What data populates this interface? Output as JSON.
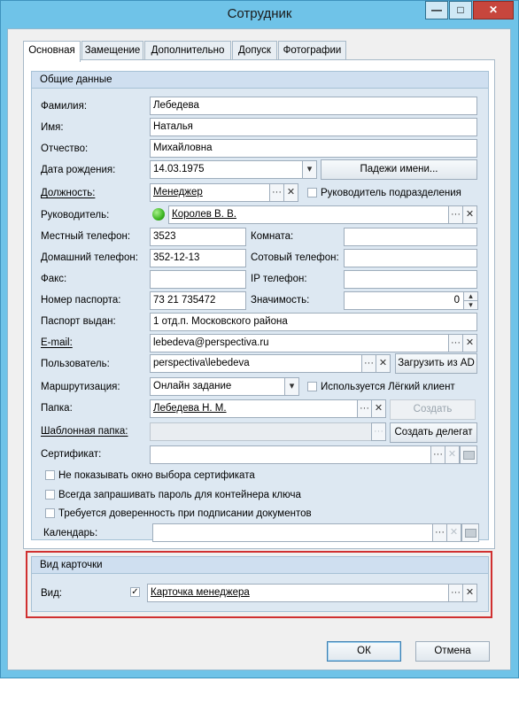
{
  "window": {
    "title": "Сотрудник",
    "minimize": "—",
    "maximize": "□",
    "close": "✕"
  },
  "tabs": [
    "Основная",
    "Замещение",
    "Дополнительно",
    "Допуск",
    "Фотографии"
  ],
  "general": {
    "header": "Общие данные",
    "last_name_label": "Фамилия:",
    "last_name": "Лебедева",
    "first_name_label": "Имя:",
    "first_name": "Наталья",
    "patronymic_label": "Отчество:",
    "patronymic": "Михайловна",
    "birth_date_label": "Дата рождения:",
    "birth_date": "14.03.1975",
    "name_cases_button": "Падежи имени...",
    "position_label": "Должность:",
    "position": "Менеджер",
    "department_head_label": "Руководитель подразделения",
    "manager_label": "Руководитель:",
    "manager": "Королев В. В.",
    "local_phone_label": "Местный телефон:",
    "local_phone": "3523",
    "room_label": "Комната:",
    "room": "",
    "home_phone_label": "Домашний телефон:",
    "home_phone": "352-12-13",
    "mobile_phone_label": "Сотовый телефон:",
    "mobile_phone": "",
    "fax_label": "Факс:",
    "fax": "",
    "ip_phone_label": "IP телефон:",
    "ip_phone": "",
    "passport_label": "Номер паспорта:",
    "passport": "73 21 735472",
    "importance_label": "Значимость:",
    "importance": "0",
    "passport_issued_label": "Паспорт выдан:",
    "passport_issued": "1 отд.п. Московского района",
    "email_label": "E-mail:",
    "email": "lebedeva@perspectiva.ru",
    "user_label": "Пользователь:",
    "user": "perspectiva\\lebedeva",
    "load_ad_button": "Загрузить из AD",
    "routing_label": "Маршрутизация:",
    "routing": "Онлайн задание",
    "light_client_label": "Используется Лёгкий клиент",
    "folder_label": "Папка:",
    "folder": "Лебедева Н. М.",
    "create_button": "Создать",
    "template_folder_label": "Шаблонная папка:",
    "template_folder": "",
    "create_delegate_button": "Создать делегат",
    "certificate_label": "Сертификат:",
    "certificate": "",
    "no_cert_window_label": "Не показывать окно выбора сертификата",
    "always_ask_password_label": "Всегда запрашивать пароль для контейнера ключа",
    "need_trust_label": "Требуется доверенность при подписании документов",
    "calendar_label": "Календарь:",
    "calendar": ""
  },
  "card_view": {
    "header": "Вид карточки",
    "view_label": "Вид:",
    "view": "Карточка менеджера"
  },
  "glyphs": {
    "ellipsis": "···",
    "clear": "✕",
    "dropdown": "▾",
    "up": "▴",
    "down": "▾",
    "check": "✓"
  },
  "footer": {
    "ok": "ОК",
    "cancel": "Отмена"
  },
  "colors": {
    "titlebar": "#6fc3e8",
    "highlight_frame": "#d03030",
    "status_green": "#3cb521"
  }
}
